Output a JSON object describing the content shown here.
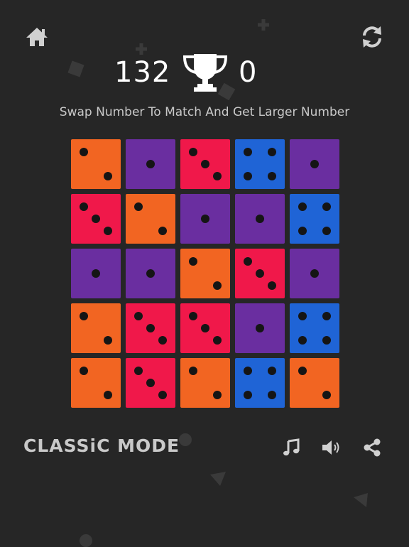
{
  "header": {
    "home_icon": "home-icon",
    "refresh_icon": "refresh-icon"
  },
  "score": {
    "current": "132",
    "best": "0",
    "trophy_icon": "trophy-icon"
  },
  "instructions": "Swap Number To Match And Get Larger Number",
  "colors": {
    "orange": "#f26522",
    "purple": "#6a2ea0",
    "red": "#f0184a",
    "blue": "#1f64d6",
    "background": "#262626",
    "pip": "#151515"
  },
  "board": {
    "rows": 5,
    "cols": 5,
    "cells": [
      [
        {
          "value": 2,
          "color": "orange"
        },
        {
          "value": 1,
          "color": "purple"
        },
        {
          "value": 3,
          "color": "red"
        },
        {
          "value": 4,
          "color": "blue"
        },
        {
          "value": 1,
          "color": "purple"
        }
      ],
      [
        {
          "value": 3,
          "color": "red"
        },
        {
          "value": 2,
          "color": "orange"
        },
        {
          "value": 1,
          "color": "purple"
        },
        {
          "value": 1,
          "color": "purple"
        },
        {
          "value": 4,
          "color": "blue"
        }
      ],
      [
        {
          "value": 1,
          "color": "purple"
        },
        {
          "value": 1,
          "color": "purple"
        },
        {
          "value": 2,
          "color": "orange"
        },
        {
          "value": 3,
          "color": "red"
        },
        {
          "value": 1,
          "color": "purple"
        }
      ],
      [
        {
          "value": 2,
          "color": "orange"
        },
        {
          "value": 3,
          "color": "red"
        },
        {
          "value": 3,
          "color": "red"
        },
        {
          "value": 1,
          "color": "purple"
        },
        {
          "value": 4,
          "color": "blue"
        }
      ],
      [
        {
          "value": 2,
          "color": "orange"
        },
        {
          "value": 3,
          "color": "red"
        },
        {
          "value": 2,
          "color": "orange"
        },
        {
          "value": 4,
          "color": "blue"
        },
        {
          "value": 2,
          "color": "orange"
        }
      ]
    ]
  },
  "footer": {
    "mode_label": "CLASSiC MODE",
    "music_icon": "music-note-icon",
    "sound_icon": "speaker-icon",
    "share_icon": "share-icon"
  }
}
